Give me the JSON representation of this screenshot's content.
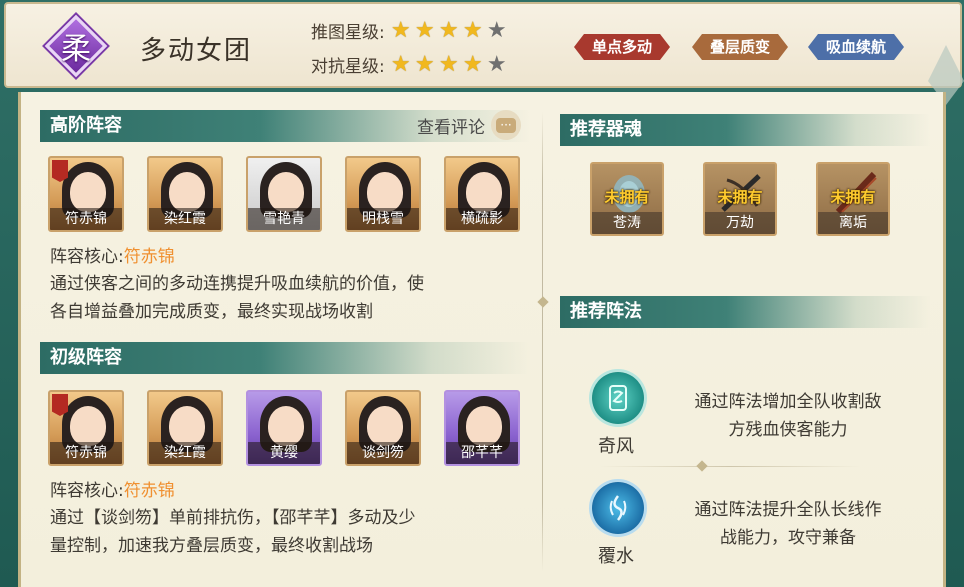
{
  "header": {
    "badge_char": "柔",
    "title": "多动女团",
    "push_rating_label": "推图星级:",
    "push_rating": 4,
    "pvp_rating_label": "对抗星级:",
    "pvp_rating": 4,
    "max_rating": 5,
    "tags": [
      {
        "label": "单点多动",
        "color": "#a8392e"
      },
      {
        "label": "叠层质变",
        "color": "#a86a3c"
      },
      {
        "label": "吸血续航",
        "color": "#4d6fa8"
      }
    ]
  },
  "advanced": {
    "title": "高阶阵容",
    "review_label": "查看评论",
    "heroes": [
      {
        "name": "符赤锦",
        "rarity": "orange",
        "core": true
      },
      {
        "name": "染红霞",
        "rarity": "orange",
        "core": false
      },
      {
        "name": "雪艳青",
        "rarity": "white",
        "core": false
      },
      {
        "name": "明栈雪",
        "rarity": "orange",
        "core": false
      },
      {
        "name": "横疏影",
        "rarity": "orange",
        "core": false
      }
    ],
    "core_label": "阵容核心:",
    "core_name": "符赤锦",
    "desc_line1": "通过侠客之间的多动连携提升吸血续航的价值，使",
    "desc_line2": "各自增益叠加完成质变，最终实现战场收割"
  },
  "basic": {
    "title": "初级阵容",
    "heroes": [
      {
        "name": "符赤锦",
        "rarity": "orange",
        "core": true
      },
      {
        "name": "染红霞",
        "rarity": "orange",
        "core": false
      },
      {
        "name": "黄缨",
        "rarity": "purple",
        "core": false
      },
      {
        "name": "谈剑笏",
        "rarity": "orange",
        "core": false
      },
      {
        "name": "邵芊芊",
        "rarity": "purple",
        "core": false
      }
    ],
    "core_label": "阵容核心:",
    "core_name": "符赤锦",
    "desc_line1": "通过【谈剑笏】单前排抗伤，【邵芊芊】多动及少",
    "desc_line2": "量控制，加速我方叠层质变，最终收割战场"
  },
  "relics": {
    "title": "推荐器魂",
    "unowned_label": "未拥有",
    "items": [
      {
        "name": "苍涛",
        "icon": "bell-icon"
      },
      {
        "name": "万劫",
        "icon": "crossbow-icon"
      },
      {
        "name": "离垢",
        "icon": "blade-icon"
      }
    ]
  },
  "formations": {
    "title": "推荐阵法",
    "items": [
      {
        "name": "奇风",
        "icon": "wind-scroll-icon",
        "desc_line1": "通过阵法增加全队收割敌",
        "desc_line2": "方残血侠客能力"
      },
      {
        "name": "覆水",
        "icon": "water-wave-icon",
        "desc_line1": "通过阵法提升全队长线作",
        "desc_line2": "战能力，攻守兼备"
      }
    ]
  }
}
